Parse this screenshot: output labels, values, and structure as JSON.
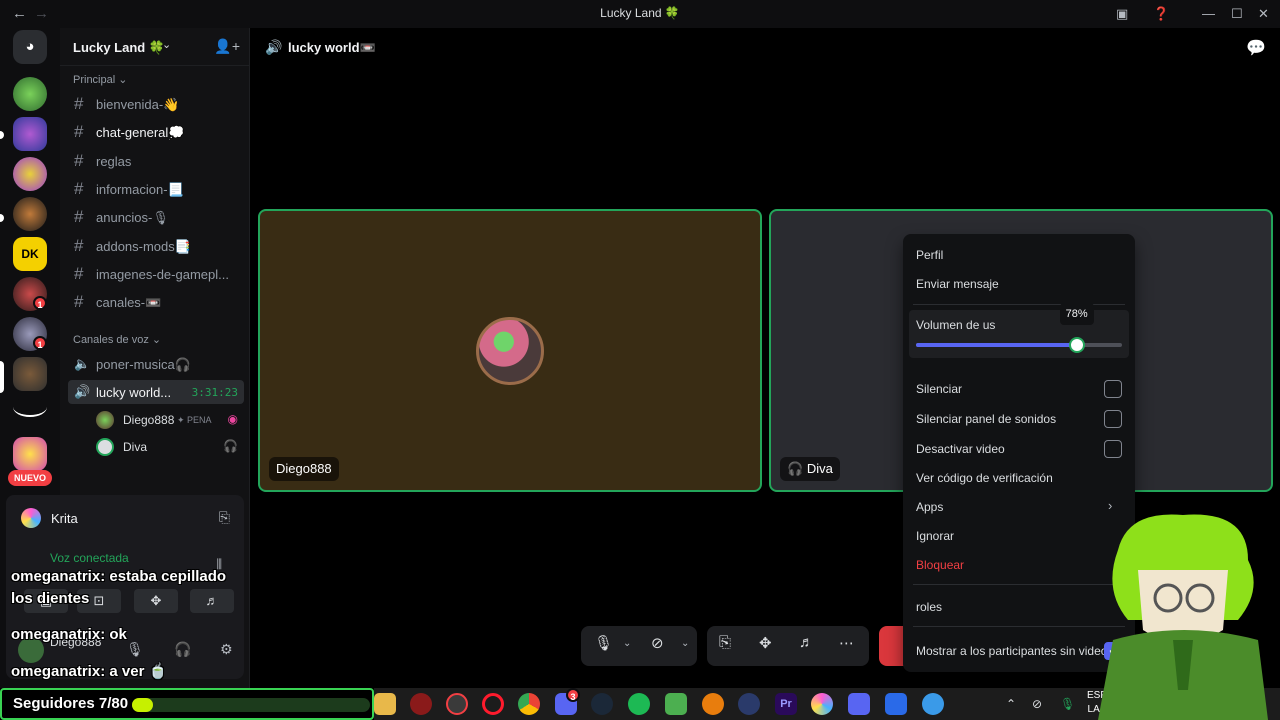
{
  "window": {
    "title": "Lucky Land 🍀",
    "back": "←",
    "forward": "→"
  },
  "server": {
    "name": "Lucky Land 🍀",
    "categories": {
      "main": "Principal ⌄",
      "voice": "Canales de voz ⌄"
    },
    "text_channels": [
      {
        "name": "bienvenida-👋"
      },
      {
        "name": "chat-general💭"
      },
      {
        "name": "reglas"
      },
      {
        "name": "informacion-📃"
      },
      {
        "name": "anuncios-🎙"
      },
      {
        "name": "addons-mods📑"
      },
      {
        "name": "imagenes-de-gamepl..."
      },
      {
        "name": "canales-📼"
      }
    ],
    "voice_channels": [
      {
        "name": "poner-musica🎧"
      },
      {
        "name": "lucky world...",
        "timer": "3:31:23"
      }
    ],
    "voice_users": [
      {
        "name": "Diego888",
        "tag": "✦ PENA"
      },
      {
        "name": "Diva",
        "tag": ""
      }
    ]
  },
  "guild_badges": [
    "1",
    "1"
  ],
  "guild_new_label": "NUEVO",
  "panel": {
    "activity_name": "Krita",
    "voice_status": "Voz conectada",
    "user_name": "Diego888"
  },
  "header": {
    "channel_name": "lucky world📼"
  },
  "tiles": [
    {
      "label": "Diego888"
    },
    {
      "label": "Diva",
      "prefix": "🎧"
    }
  ],
  "context_menu": {
    "profile": "Perfil",
    "message": "Enviar mensaje",
    "volume_label": "Volumen de us",
    "volume_value": 0.78,
    "volume_tooltip": "78%",
    "mute": "Silenciar",
    "mute_soundboard": "Silenciar panel de sonidos",
    "disable_video": "Desactivar video",
    "verify_code": "Ver código de verificación",
    "apps": "Apps",
    "ignore": "Ignorar",
    "block": "Bloquear",
    "roles": "roles",
    "show_non_video": "Mostrar a los participantes sin video"
  },
  "chat_overlay": [
    {
      "user": "omeganatrix:",
      "text": " estaba cepillado"
    },
    {
      "user": "",
      "text": "los dientes"
    },
    {
      "user": "omeganatrix:",
      "text": " ok"
    },
    {
      "user": "omeganatrix:",
      "text": " a ver 🍵"
    }
  ],
  "followers": {
    "text": "Seguidores 7/80",
    "current": 7,
    "goal": 80
  },
  "taskbar": {
    "lang_top": "ESP",
    "lang_bottom": "LAA",
    "discord_badge": "3"
  },
  "colors": {
    "accent": "#5865f2",
    "speaking": "#23a55a",
    "danger": "#f23f43",
    "follower_bar": "#c6f000"
  }
}
